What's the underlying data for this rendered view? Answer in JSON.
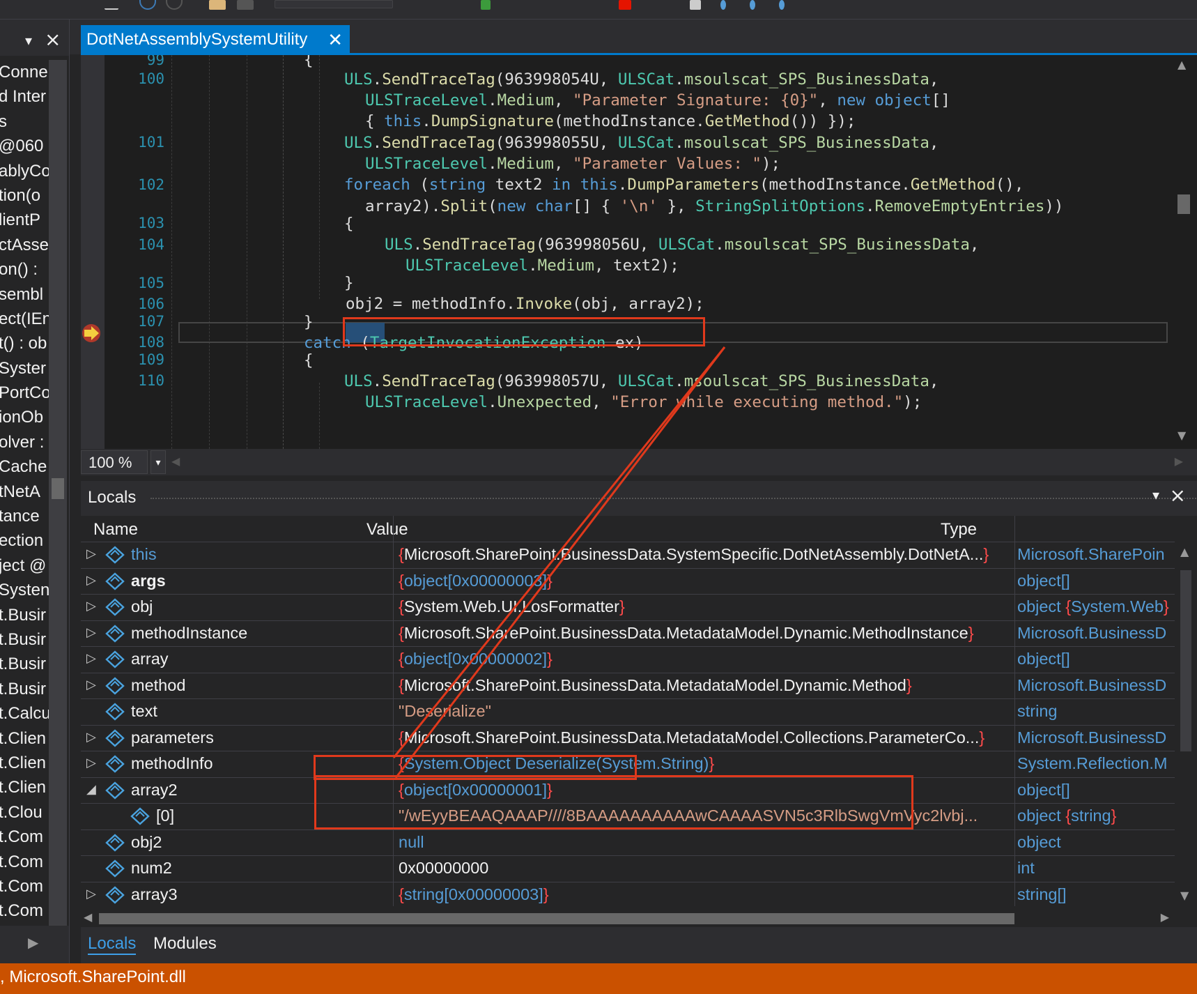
{
  "document_tab": {
    "title": "DotNetAssemblySystemUtility",
    "close": "✕"
  },
  "left_panel": {
    "items": [
      [
        "Conne",
        ""
      ],
      [
        "d Inter",
        ""
      ],
      [
        "s",
        ""
      ],
      [
        "@060",
        ""
      ],
      [
        "ablyCo",
        ""
      ],
      [
        "tion(o",
        ""
      ],
      [
        "lientP",
        ""
      ],
      [
        "ctAsse",
        ""
      ],
      [
        "on() : ",
        ""
      ],
      [
        "sembl",
        ""
      ],
      [
        "ect(IEn",
        ""
      ],
      [
        "t() : ob",
        ""
      ],
      [
        "Syster",
        ""
      ],
      [
        "PortCo",
        ""
      ],
      [
        "ionOb",
        ""
      ],
      [
        "olver :",
        ""
      ],
      [
        "Cache",
        ""
      ],
      [
        "tNetA",
        ""
      ],
      [
        "tance",
        ""
      ],
      [
        "ection",
        ""
      ],
      [
        "ject @",
        ""
      ],
      [
        "Systen",
        ""
      ],
      [
        "t.Busir",
        ""
      ],
      [
        "t.Busir",
        ""
      ],
      [
        "t.Busir",
        ""
      ],
      [
        "t.Busir",
        ""
      ],
      [
        "t.Calcu",
        ""
      ],
      [
        "t.Clien",
        ""
      ],
      [
        "t.Clien",
        ""
      ],
      [
        "t.Clien",
        ""
      ],
      [
        "t.Clou",
        ""
      ],
      [
        "t.Com",
        ""
      ],
      [
        "t.Com",
        ""
      ],
      [
        "t.Com",
        ""
      ],
      [
        "t.Com",
        ""
      ]
    ]
  },
  "editor": {
    "zoom": "100 %",
    "line_numbers": [
      "99",
      "100",
      "101",
      "102",
      "103",
      "104",
      "105",
      "106",
      "107",
      "108",
      "109",
      "110"
    ]
  },
  "locals": {
    "title": "Locals",
    "columns": {
      "name": "Name",
      "value": "Value",
      "type": "Type"
    },
    "rows": [
      {
        "name": "this",
        "value": "Microsoft.SharePoint.BusinessData.SystemSpecific.DotNetAssembly.DotNetA...",
        "type": "Microsoft.SharePoin"
      },
      {
        "name": "args",
        "value": "object[0x00000003]",
        "type": "object[]"
      },
      {
        "name": "obj",
        "value": "System.Web.UI.LosFormatter",
        "type": "object",
        "type2": "System.Web"
      },
      {
        "name": "methodInstance",
        "value": "Microsoft.SharePoint.BusinessData.MetadataModel.Dynamic.MethodInstance",
        "type": "Microsoft.BusinessD"
      },
      {
        "name": "array",
        "value": "object[0x00000002]",
        "type": "object[]"
      },
      {
        "name": "method",
        "value": "Microsoft.SharePoint.BusinessData.MetadataModel.Dynamic.Method",
        "type": "Microsoft.BusinessD"
      },
      {
        "name": "text",
        "value": "\"Deserialize\"",
        "type": "string"
      },
      {
        "name": "parameters",
        "value": "Microsoft.SharePoint.BusinessData.MetadataModel.Collections.ParameterCo...",
        "type": "Microsoft.BusinessD"
      },
      {
        "name": "methodInfo",
        "value": "System.Object Deserialize(System.String)",
        "type": "System.Reflection.M"
      },
      {
        "name": "array2",
        "value": "object[0x00000001]",
        "type": "object[]"
      },
      {
        "name": "[0]",
        "value": "\"/wEyyBEAAQAAAP////8BAAAAAAAAAAwCAAAASVN5c3RlbSwgVmVyc2lvbj...",
        "type": "object",
        "type2": "string"
      },
      {
        "name": "obj2",
        "value": "null",
        "type": "object"
      },
      {
        "name": "num2",
        "value": "0x00000000",
        "type": "int"
      },
      {
        "name": "array3",
        "value": "string[0x00000003]",
        "type": "string[]"
      }
    ]
  },
  "bottom_tabs": {
    "locals": "Locals",
    "modules": "Modules"
  },
  "status_bar": {
    "text": ", Microsoft.SharePoint.dll"
  }
}
